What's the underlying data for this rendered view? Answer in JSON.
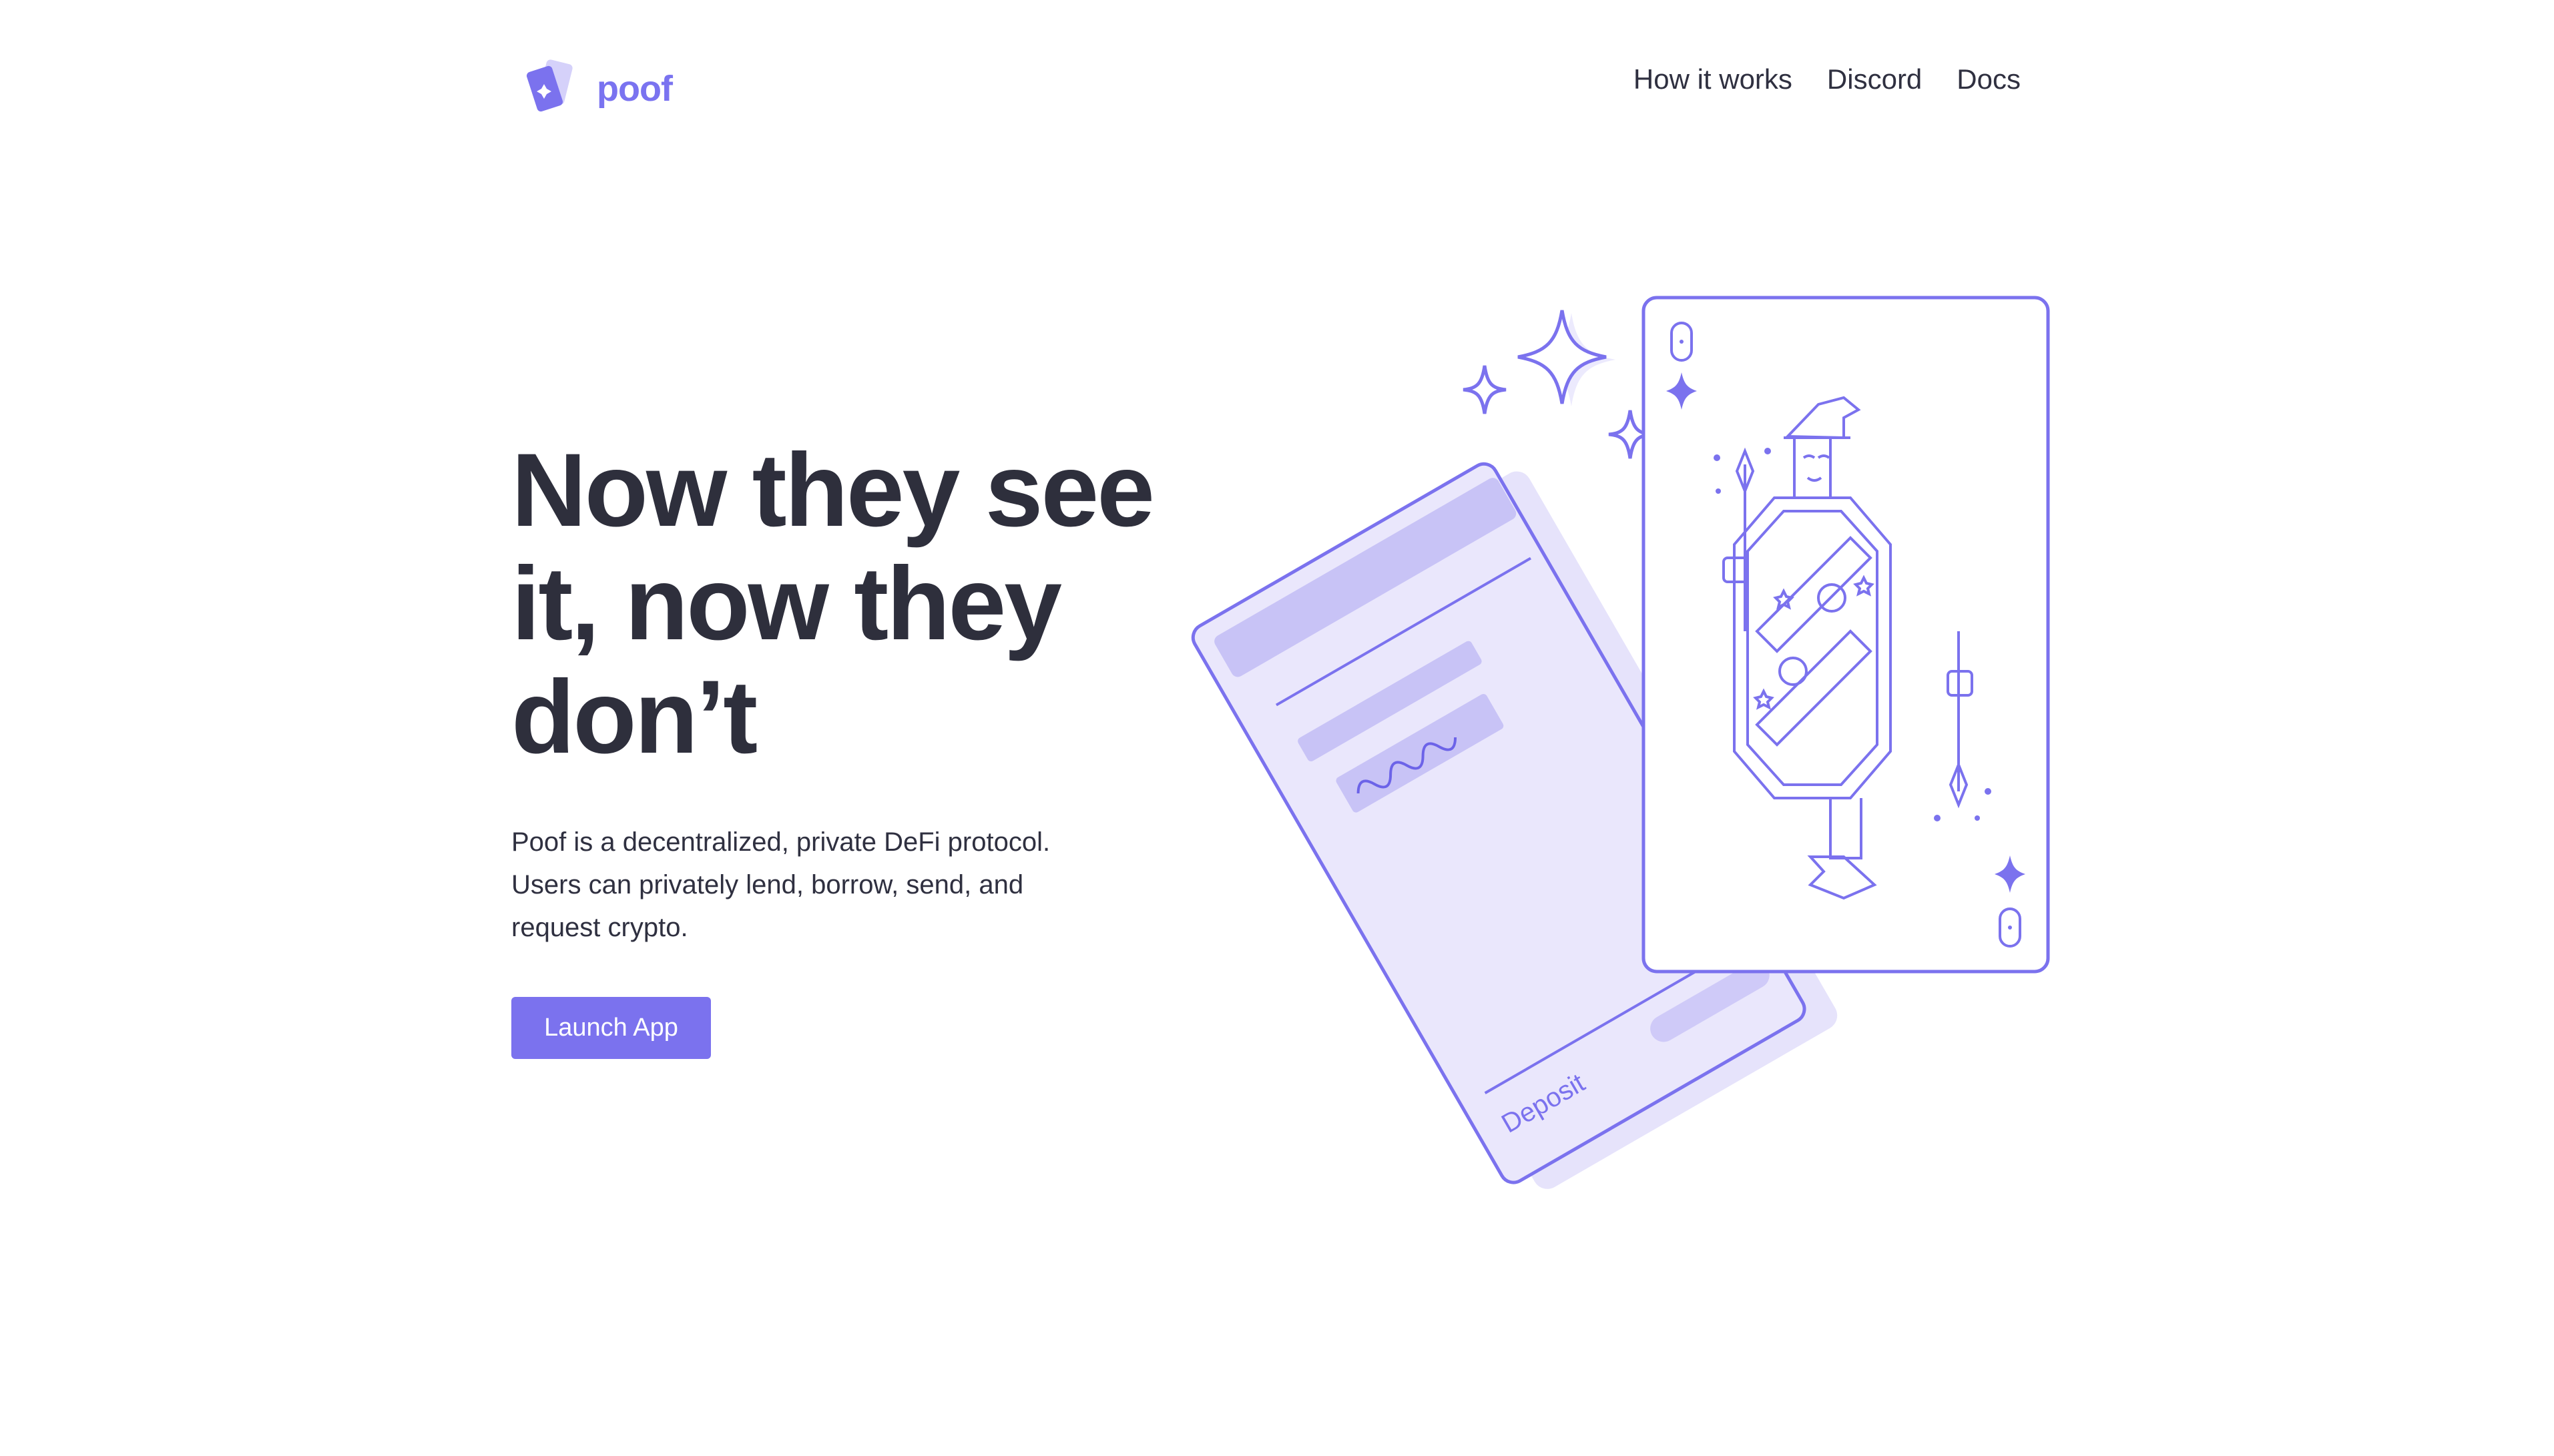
{
  "brand": {
    "name": "poof",
    "logo_icon": "stacked-cards-logo-icon"
  },
  "nav": {
    "items": [
      {
        "label": "How it works"
      },
      {
        "label": "Discord"
      },
      {
        "label": "Docs"
      }
    ]
  },
  "hero": {
    "headline_lines": [
      "Now they see",
      "it, now they",
      "don’t"
    ],
    "description_lines": [
      "Poof is a decentralized, private DeFi protocol.",
      "Users can privately lend, borrow, send, and",
      "request crypto."
    ],
    "cta_label": "Launch App"
  },
  "illustration": {
    "deposit_label": "Deposit",
    "playing_card": "queen-of-diamonds-wizard",
    "sparkle_icons": [
      "sparkle-icon",
      "sparkle-icon",
      "sparkle-icon"
    ]
  },
  "colors": {
    "accent": "#7B72EE",
    "accent_light": "#C9C5F7",
    "accent_faint": "#E9E6FB",
    "text_dark": "#2E2F3C",
    "background": "#FFFFFF"
  }
}
